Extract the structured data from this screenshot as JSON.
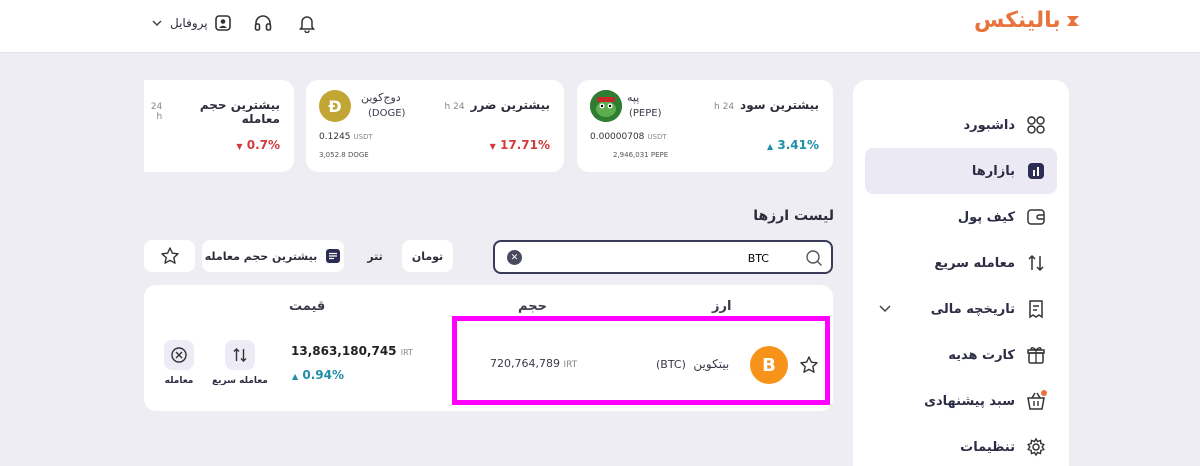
{
  "header": {
    "logo_text": "بالینکس",
    "profile_label": "پروفایل",
    "brand_color": "#e8733c"
  },
  "sidebar": {
    "items": [
      {
        "label": "داشبورد",
        "icon": "grid-icon"
      },
      {
        "label": "بازارها",
        "icon": "chart-icon",
        "active": true
      },
      {
        "label": "کیف پول",
        "icon": "wallet-icon"
      },
      {
        "label": "معامله سریع",
        "icon": "swap-icon"
      },
      {
        "label": "تاریخچه مالی",
        "icon": "receipt-icon"
      },
      {
        "label": "کارت هدیه",
        "icon": "gift-icon"
      },
      {
        "label": "سبد پیشنهادی",
        "icon": "basket-icon"
      },
      {
        "label": "تنظیمات",
        "icon": "gear-icon"
      }
    ]
  },
  "cards": {
    "profit": {
      "title": "بیشترین سود",
      "tag": "24 h",
      "coin_name": "پپه",
      "coin_symbol": "(PEPE)",
      "price": "0.00000708",
      "price_unit": "USDT",
      "volume": "2,946,031",
      "volume_unit": "PEPE",
      "change": "3.41%"
    },
    "loss": {
      "title": "بیشترین ضرر",
      "tag": "24 h",
      "coin_name": "دوج‌کوین",
      "coin_symbol": "(DOGE)",
      "price": "0.1245",
      "price_unit": "USDT",
      "volume": "3,052.8",
      "volume_unit": "DOGE",
      "change": "17.71%",
      "coin_letter": "Ð"
    },
    "volume": {
      "title": "بیشترین حجم معامله",
      "tag": "24 h",
      "change": "0.7%"
    }
  },
  "list": {
    "title": "لیست ارزها",
    "search_value": "BTC",
    "tabs": {
      "toman": "تومان",
      "tether": "تتر"
    },
    "sort_label": "بیشترین حجم معامله"
  },
  "table": {
    "headers": {
      "currency": "ارز",
      "volume": "حجم",
      "price": "قیمت"
    },
    "row": {
      "name": "بیتکوین",
      "symbol": "(BTC)",
      "coin_letter": "B",
      "volume": "720,764,789",
      "volume_unit": "IRT",
      "price": "13,863,180,745",
      "price_unit": "IRT",
      "change": "0.94%",
      "quick_trade_label": "معامله سریع",
      "trade_label": "معامله"
    }
  }
}
